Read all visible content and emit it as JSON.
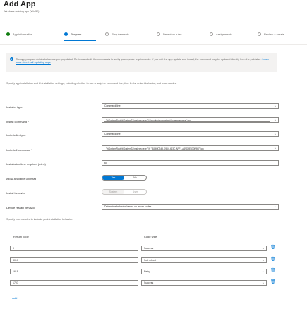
{
  "header": {
    "title": "Add App",
    "subtitle": "Windows catalog app (Win32)"
  },
  "steps": [
    {
      "label": "App information",
      "state": "done"
    },
    {
      "label": "Program",
      "state": "active"
    },
    {
      "label": "Requirements",
      "state": "pending"
    },
    {
      "label": "Detection rules",
      "state": "pending"
    },
    {
      "label": "Assignments",
      "state": "pending"
    },
    {
      "label": "Review + create",
      "state": "pending"
    }
  ],
  "info": {
    "text": "The app program details below are pre-populated. Review and edit the commands to verify your update requirements. If you edit the app update and install, the command may be updated directly from the publisher.",
    "link": "Learn more about self-updating apps"
  },
  "description": "Specify app installation and Uninstallation settings, including whether to use a script or command line, time limits, restart behavior, and return codes.",
  "fields": {
    "installer_type": {
      "label": "Installer type",
      "value": "Command line"
    },
    "install_command": {
      "label": "Install command *",
      "value": "\"%SystemRoot%\\System32\\msiexec.exe\" /i \"googlechromestandaloneenterprise\" /qn"
    },
    "uninstaller_type": {
      "label": "Uninstaller type",
      "value": "Command line"
    },
    "uninstall_command": {
      "label": "Uninstall command *",
      "value": "\"%SystemRoot%\\System32\\msiexec.exe\" /X \"{8A69D345-D564-463C-AFF1-A69D9E530F96}\" /qn"
    },
    "install_time": {
      "label": "Installation time required (mins)",
      "value": "60"
    },
    "allow_uninstall": {
      "label": "Allow available uninstall",
      "yes": "Yes",
      "no": "No"
    },
    "install_behavior": {
      "label": "Install behavior",
      "system": "System",
      "user": "User"
    },
    "restart_behavior": {
      "label": "Device restart behavior",
      "value": "Determine behavior based on return codes"
    }
  },
  "return_codes": {
    "description": "Specify return codes to indicate post-installation behavior:",
    "col_code": "Return code",
    "col_type": "Code type",
    "rows": [
      {
        "code": "0",
        "type": "Success"
      },
      {
        "code": "3010",
        "type": "Soft reboot"
      },
      {
        "code": "1618",
        "type": "Retry"
      },
      {
        "code": "1707",
        "type": "Success"
      }
    ],
    "add_label": "+ Add"
  }
}
